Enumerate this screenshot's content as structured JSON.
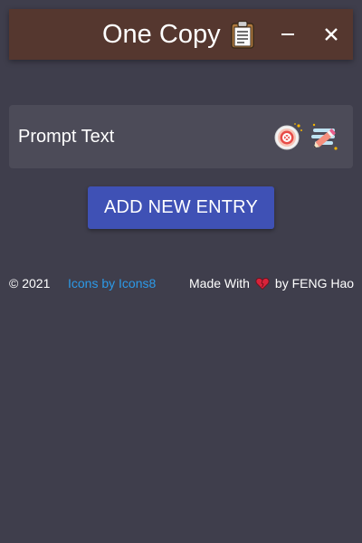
{
  "window": {
    "title": "One Copy",
    "title_icon": "clipboard-icon",
    "minimize_icon": "minimize-icon",
    "close_icon": "close-icon"
  },
  "entries": [
    {
      "text": "Prompt Text",
      "copy_icon": "target-copy-icon",
      "edit_icon": "pencil-edit-icon"
    }
  ],
  "actions": {
    "add_label": "ADD NEW ENTRY"
  },
  "footer": {
    "copyright": "© 2021",
    "icons_credit": "Icons by Icons8",
    "made_with": "Made With",
    "heart_icon": "heart-icon",
    "author": "by FENG Hao"
  },
  "colors": {
    "background": "#3f3e4c",
    "titlebar": "#55372f",
    "card": "#4c4b58",
    "primary_button": "#3f51b5",
    "link": "#2c9ae8"
  }
}
